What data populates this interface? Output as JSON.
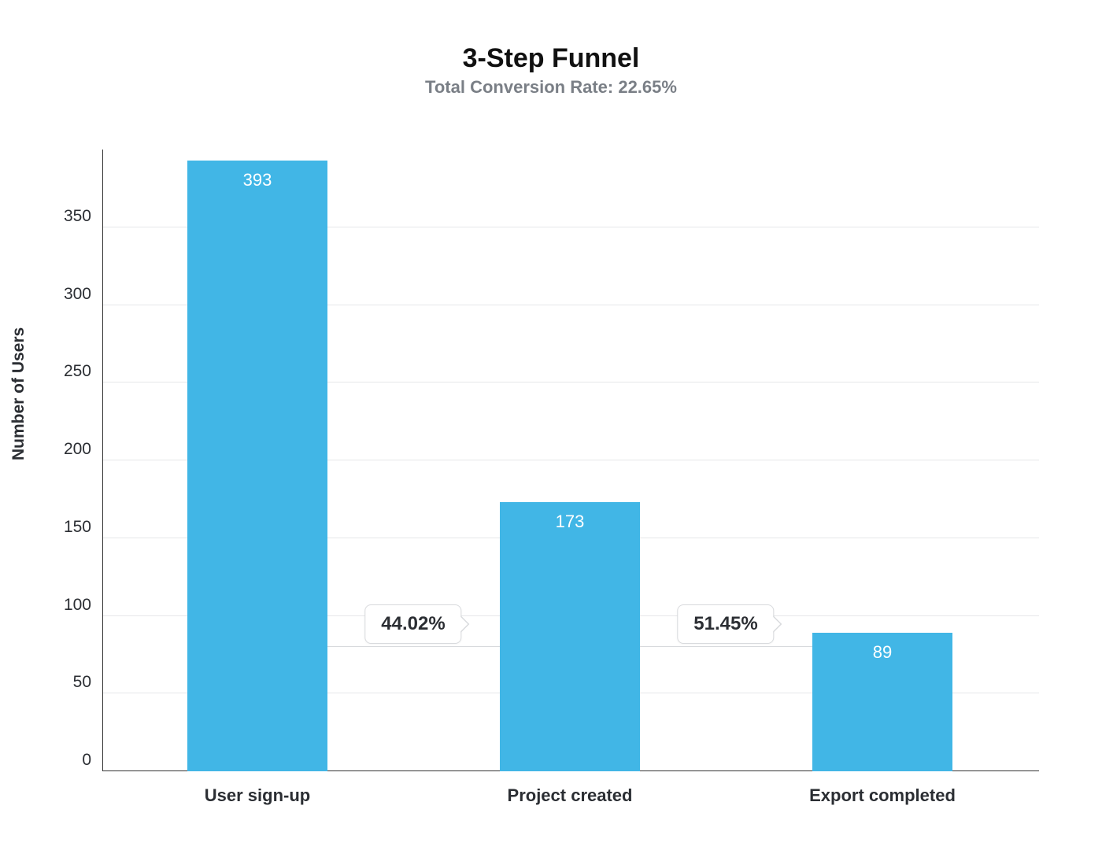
{
  "chart_data": {
    "type": "bar",
    "title": "3-Step Funnel",
    "subtitle": "Total Conversion Rate: 22.65%",
    "ylabel": "Number of Users",
    "xlabel": "",
    "categories": [
      "User sign-up",
      "Project created",
      "Export completed"
    ],
    "values": [
      393,
      173,
      89
    ],
    "value_labels": [
      "393",
      "173",
      "89"
    ],
    "step_conversions": [
      "44.02%",
      "51.45%"
    ],
    "y_ticks": [
      0,
      50,
      100,
      150,
      200,
      250,
      300,
      350
    ],
    "ylim": [
      0,
      400
    ],
    "bar_color": "#41b6e6",
    "grid": true
  }
}
